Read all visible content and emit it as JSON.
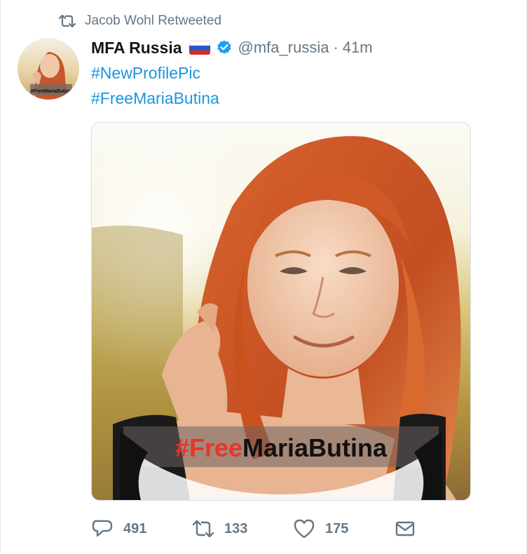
{
  "context": {
    "icon": "retweet-icon",
    "text": "Jacob Wohl Retweeted"
  },
  "author": {
    "name": "MFA Russia",
    "flag_icon": "russia-flag-icon",
    "verified_icon": "verified-badge-icon",
    "handle": "@mfa_russia",
    "separator": "·",
    "time": "41m",
    "avatar_caption": "#FreeMariaButina"
  },
  "tweet": {
    "hashtags": [
      "#NewProfilePic",
      "#FreeMariaButina"
    ]
  },
  "media": {
    "overlay_text_red": "#Free",
    "overlay_text_black": "MariaButina"
  },
  "actions": {
    "reply": {
      "icon": "reply-icon",
      "count": "491"
    },
    "retweet": {
      "icon": "retweet-icon",
      "count": "133"
    },
    "like": {
      "icon": "heart-icon",
      "count": "175"
    },
    "message": {
      "icon": "envelope-icon"
    }
  },
  "colors": {
    "link": "#1b95e0",
    "muted": "#657786",
    "verified": "#1da1f2",
    "overlay_red": "#e8342c"
  }
}
